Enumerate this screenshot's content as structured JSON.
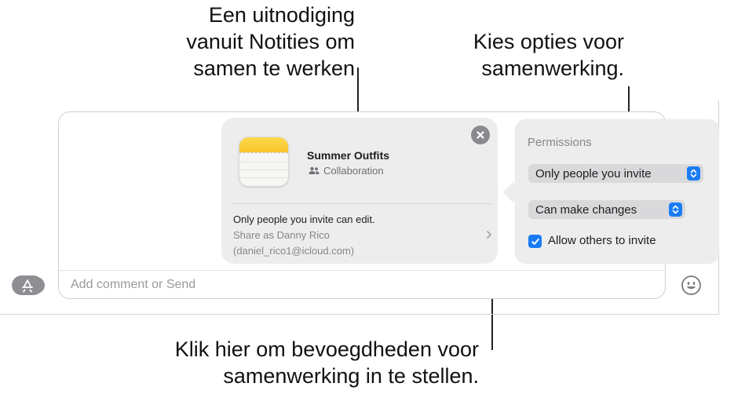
{
  "callouts": {
    "top_left": [
      "Een uitnodiging",
      "vanuit Notities om",
      "samen te werken"
    ],
    "top_right": [
      "Kies opties voor",
      "samenwerking."
    ],
    "bottom": [
      "Klik hier om bevoegdheden voor",
      "samenwerking in te stellen."
    ]
  },
  "card": {
    "title": "Summer Outfits",
    "subtitle": "Collaboration",
    "info": "Only people you invite can edit.",
    "share_line1": "Share as Danny Rico",
    "share_line2": "(daniel_rico1@icloud.com)"
  },
  "permissions": {
    "heading": "Permissions",
    "access_value": "Only people you invite",
    "edit_value": "Can make changes",
    "allow_invite_label": "Allow others to invite",
    "allow_invite_checked": true
  },
  "composer": {
    "placeholder": "Add comment or Send"
  },
  "colors": {
    "accent": "#1a7cf5",
    "card_bg": "#ededee",
    "notes_yellow": "#f7c62c"
  },
  "icons": [
    "app-store-icon",
    "emoji-icon",
    "close-icon",
    "collaboration-icon",
    "chevron-right-icon",
    "notes-app-icon",
    "stepper-icon",
    "checkmark-icon"
  ]
}
